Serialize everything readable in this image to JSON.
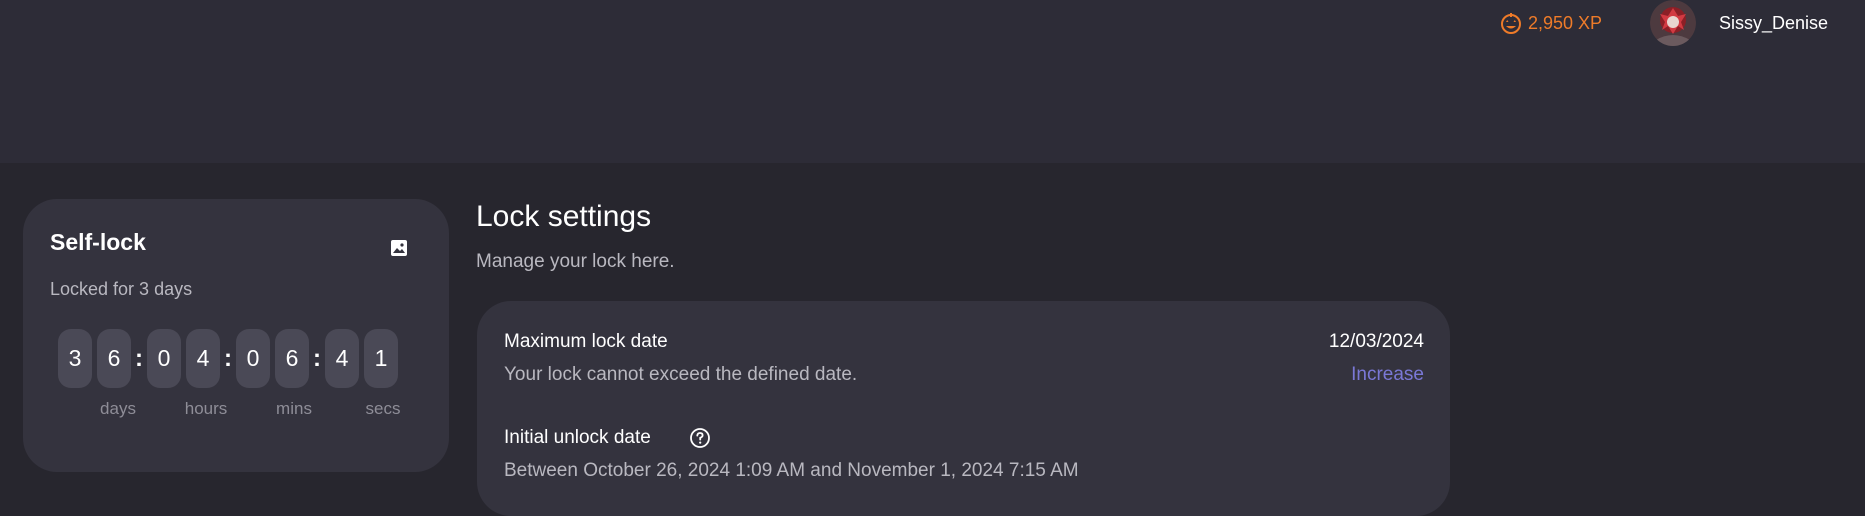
{
  "header": {
    "xp_icon": "pumpkin-icon",
    "xp_text": "2,950 XP",
    "xp_color": "#ee7b29",
    "username": "Sissy_Denise"
  },
  "self_lock": {
    "title": "Self-lock",
    "image_icon": "image-icon",
    "subtitle": "Locked for 3 days",
    "timer": {
      "days": [
        "3",
        "6"
      ],
      "hours": [
        "0",
        "4"
      ],
      "mins": [
        "0",
        "6"
      ],
      "secs": [
        "4",
        "1"
      ],
      "separator": ":"
    },
    "units": {
      "days": "days",
      "hours": "hours",
      "mins": "mins",
      "secs": "secs"
    }
  },
  "lock_settings": {
    "title": "Lock settings",
    "subtitle": "Manage your lock here.",
    "max_date": {
      "label": "Maximum lock date",
      "description": "Your lock cannot exceed the defined date.",
      "value": "12/03/2024",
      "action": "Increase"
    },
    "initial_unlock": {
      "label": "Initial unlock date",
      "help_icon": "help-circle-icon",
      "description": "Between October 26, 2024 1:09 AM and November 1, 2024 7:15 AM"
    }
  },
  "colors": {
    "background": "#27262e",
    "topbar": "#2d2c37",
    "card": "#34333e",
    "digit_box": "#4a4956",
    "link": "#7a78d6"
  }
}
